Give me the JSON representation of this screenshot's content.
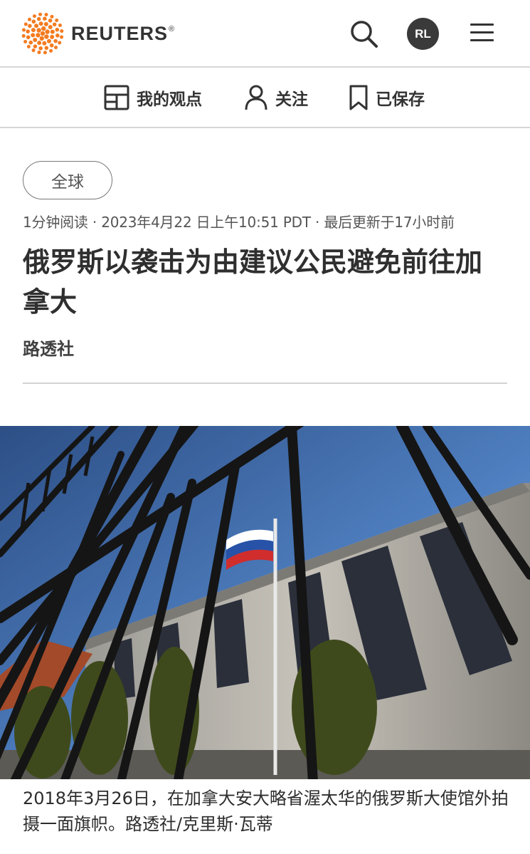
{
  "header": {
    "brand": "REUTERS",
    "registered_mark": "®",
    "avatar_initials": "RL",
    "icons": {
      "logo": "reuters-logo-icon",
      "search": "search-icon",
      "menu": "hamburger-menu-icon"
    }
  },
  "subnav": {
    "items": [
      {
        "label": "我的观点",
        "icon": "dashboard-icon"
      },
      {
        "label": "关注",
        "icon": "person-icon"
      },
      {
        "label": "已保存",
        "icon": "bookmark-icon"
      }
    ]
  },
  "article": {
    "tag": "全球",
    "meta": "1分钟阅读 · 2023年4月22 日上午10:51 PDT · 最后更新于17小时前",
    "title": "俄罗斯以袭击为由建议公民避免前往加拿大",
    "byline": "路透社",
    "image_caption": "2018年3月26日，在加拿大安大略省渥太华的俄罗斯大使馆外拍摄一面旗帜。路透社/克里斯·瓦蒂"
  },
  "colors": {
    "brand_orange": "#f47b20",
    "text_dark": "#2b2b2b",
    "divider": "#d6d6d6"
  }
}
